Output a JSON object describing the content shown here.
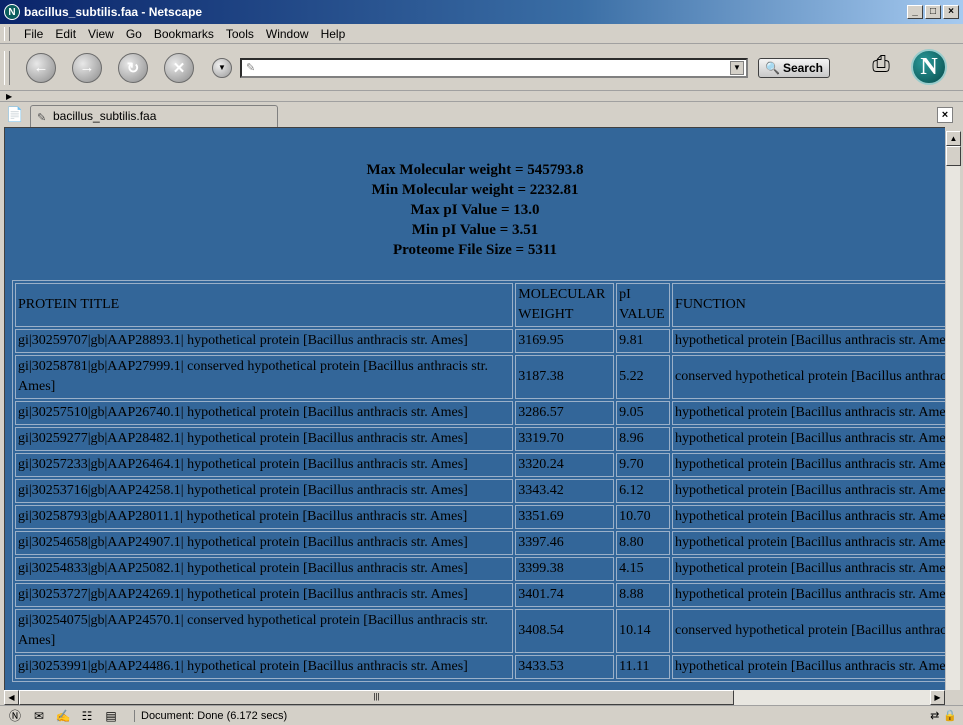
{
  "window": {
    "title": "bacillus_subtilis.faa - Netscape"
  },
  "menu": [
    "File",
    "Edit",
    "View",
    "Go",
    "Bookmarks",
    "Tools",
    "Window",
    "Help"
  ],
  "toolbar": {
    "url_value": "",
    "search_label": "Search"
  },
  "tab": {
    "label": "bacillus_subtilis.faa"
  },
  "stats": {
    "max_mw": "Max Molecular weight = 545793.8",
    "min_mw": "Min Molecular weight = 2232.81",
    "max_pi": "Max pI Value = 13.0",
    "min_pi": "Min pI Value = 3.51",
    "file_size": "Proteome File Size = 5311"
  },
  "table": {
    "headers": [
      "PROTEIN TITLE",
      "MOLECULAR WEIGHT",
      "pI VALUE",
      "FUNCTION"
    ],
    "rows": [
      [
        "gi|30259707|gb|AAP28893.1| hypothetical protein [Bacillus anthracis str. Ames]",
        "3169.95",
        "9.81",
        "hypothetical protein [Bacillus anthracis str. Ames]"
      ],
      [
        "gi|30258781|gb|AAP27999.1| conserved hypothetical protein [Bacillus anthracis str. Ames]",
        "3187.38",
        "5.22",
        "conserved hypothetical protein [Bacillus anthracis str. Ames]"
      ],
      [
        "gi|30257510|gb|AAP26740.1| hypothetical protein [Bacillus anthracis str. Ames]",
        "3286.57",
        "9.05",
        "hypothetical protein [Bacillus anthracis str. Ames]"
      ],
      [
        "gi|30259277|gb|AAP28482.1| hypothetical protein [Bacillus anthracis str. Ames]",
        "3319.70",
        "8.96",
        "hypothetical protein [Bacillus anthracis str. Ames]"
      ],
      [
        "gi|30257233|gb|AAP26464.1| hypothetical protein [Bacillus anthracis str. Ames]",
        "3320.24",
        "9.70",
        "hypothetical protein [Bacillus anthracis str. Ames]"
      ],
      [
        "gi|30253716|gb|AAP24258.1| hypothetical protein [Bacillus anthracis str. Ames]",
        "3343.42",
        "6.12",
        "hypothetical protein [Bacillus anthracis str. Ames]"
      ],
      [
        "gi|30258793|gb|AAP28011.1| hypothetical protein [Bacillus anthracis str. Ames]",
        "3351.69",
        "10.70",
        "hypothetical protein [Bacillus anthracis str. Ames]"
      ],
      [
        "gi|30254658|gb|AAP24907.1| hypothetical protein [Bacillus anthracis str. Ames]",
        "3397.46",
        "8.80",
        "hypothetical protein [Bacillus anthracis str. Ames]"
      ],
      [
        "gi|30254833|gb|AAP25082.1| hypothetical protein [Bacillus anthracis str. Ames]",
        "3399.38",
        "4.15",
        "hypothetical protein [Bacillus anthracis str. Ames]"
      ],
      [
        "gi|30253727|gb|AAP24269.1| hypothetical protein [Bacillus anthracis str. Ames]",
        "3401.74",
        "8.88",
        "hypothetical protein [Bacillus anthracis str. Ames]"
      ],
      [
        "gi|30254075|gb|AAP24570.1| conserved hypothetical protein [Bacillus anthracis str. Ames]",
        "3408.54",
        "10.14",
        "conserved hypothetical protein [Bacillus anthracis str. Ames]"
      ],
      [
        "gi|30253991|gb|AAP24486.1| hypothetical protein [Bacillus anthracis str. Ames]",
        "3433.53",
        "11.11",
        "hypothetical protein [Bacillus anthracis str. Ames]"
      ]
    ]
  },
  "status": {
    "text": "Document: Done (6.172 secs)"
  },
  "colors": {
    "page_bg": "#336699",
    "chrome_bg": "#d4d0c8"
  }
}
